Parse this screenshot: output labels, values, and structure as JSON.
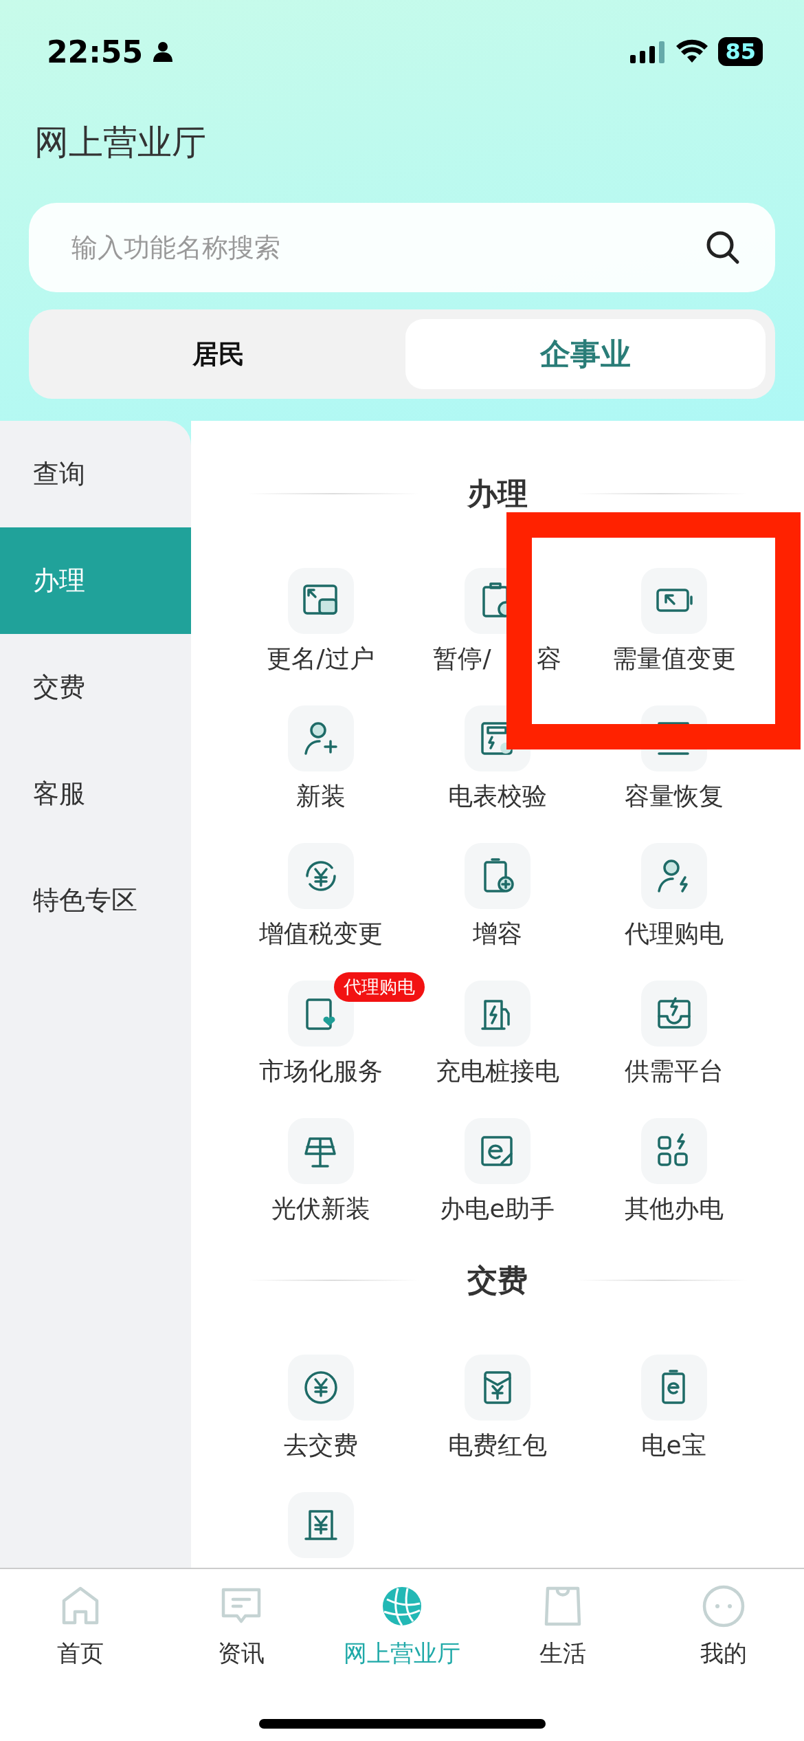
{
  "status_bar": {
    "time": "22:55",
    "battery": "85"
  },
  "title": "网上营业厅",
  "search": {
    "placeholder": "输入功能名称搜索"
  },
  "segments": [
    {
      "label": "居民",
      "selected": false
    },
    {
      "label": "企事业",
      "selected": true
    }
  ],
  "sidebar": {
    "items": [
      {
        "label": "查询",
        "selected": false
      },
      {
        "label": "办理",
        "selected": true
      },
      {
        "label": "交费",
        "selected": false
      },
      {
        "label": "客服",
        "selected": false
      },
      {
        "label": "特色专区",
        "selected": false
      }
    ]
  },
  "sections": [
    {
      "title": "办理",
      "items": [
        {
          "label": "更名/过户",
          "kind": "transfer"
        },
        {
          "label_parts": [
            "暂停/",
            "容"
          ],
          "kind": "pause"
        },
        {
          "label": "需量值变更",
          "kind": "demand"
        },
        {
          "label": "新装",
          "kind": "useradd"
        },
        {
          "label": "电表校验",
          "kind": "meter"
        },
        {
          "label": "容量恢复",
          "kind": "restore"
        },
        {
          "label": "增值税变更",
          "kind": "tax"
        },
        {
          "label": "增容",
          "kind": "capacity"
        },
        {
          "label": "代理购电",
          "kind": "agent"
        },
        {
          "label": "市场化服务",
          "kind": "market",
          "badge": "代理购电"
        },
        {
          "label": "充电桩接电",
          "kind": "charger"
        },
        {
          "label": "供需平台",
          "kind": "platform"
        },
        {
          "label": "光伏新装",
          "kind": "solar"
        },
        {
          "label": "办电e助手",
          "kind": "eassist"
        },
        {
          "label": "其他办电",
          "kind": "others"
        }
      ]
    },
    {
      "title": "交费",
      "items": [
        {
          "label": "去交费",
          "kind": "coin"
        },
        {
          "label": "电费红包",
          "kind": "envelope"
        },
        {
          "label": "电e宝",
          "kind": "ebattery"
        },
        {
          "kind": "counter"
        }
      ]
    }
  ],
  "tabbar": [
    {
      "label": "首页",
      "kind": "home",
      "selected": false
    },
    {
      "label": "资讯",
      "kind": "chat",
      "selected": false
    },
    {
      "label": "网上营业厅",
      "kind": "globe",
      "selected": true
    },
    {
      "label": "生活",
      "kind": "bag",
      "selected": false
    },
    {
      "label": "我的",
      "kind": "face",
      "selected": false
    }
  ]
}
